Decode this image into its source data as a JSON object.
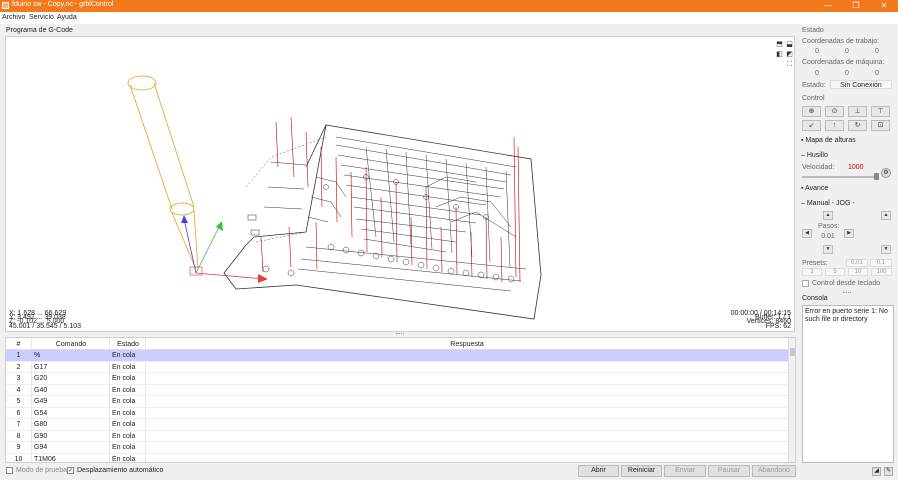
{
  "window": {
    "title": "fduino sw - Copy.nc - grblControl",
    "min": "—",
    "max": "❐",
    "close": "✕"
  },
  "menu": [
    "Archivo",
    "Servicio",
    "Ayuda"
  ],
  "gcode_section": "Programa de G-Code",
  "viewport": {
    "left_lines": [
      "X: 1.628 ... 66.629",
      "Y: 3.492 ... 39.038",
      "Z: -0.102 ... 5.000",
      "45.001 / 35.545 / 5.103"
    ],
    "right_lines": [
      "00:00:00 / 00:14:15",
      "Buffer: 1 / 1",
      "Vertices: 8460",
      "FPS: 62"
    ]
  },
  "table": {
    "headers": [
      "#",
      "Comando",
      "Estado",
      "Respuesta"
    ],
    "rows": [
      [
        "1",
        "%",
        "En cola",
        ""
      ],
      [
        "2",
        "G17",
        "En cola",
        ""
      ],
      [
        "3",
        "G20",
        "En cola",
        ""
      ],
      [
        "4",
        "G40",
        "En cola",
        ""
      ],
      [
        "5",
        "G49",
        "En cola",
        ""
      ],
      [
        "6",
        "G54",
        "En cola",
        ""
      ],
      [
        "7",
        "G80",
        "En cola",
        ""
      ],
      [
        "8",
        "G90",
        "En cola",
        ""
      ],
      [
        "9",
        "G94",
        "En cola",
        ""
      ],
      [
        "10",
        "T1M06",
        "En cola",
        ""
      ]
    ]
  },
  "bottom": {
    "test_mode": "Modo de prueba",
    "autoscroll": "Desplazamiento automático",
    "buttons": [
      "Abrir",
      "Reiniciar",
      "Enviar",
      "Pausar",
      "Abandono"
    ]
  },
  "panel": {
    "estado_title": "Estado",
    "work_coords": "Coordenadas de trabajo:",
    "work_values": [
      "0",
      "0",
      "0"
    ],
    "machine_coords": "Coordenadas de máquina:",
    "machine_values": [
      "0",
      "0",
      "0"
    ],
    "status_label": "Estado:",
    "status_value": "Sin Conexión",
    "control_title": "Control",
    "heightmap": "Mapa de alturas",
    "spindle": "Husillo",
    "speed_label": "Velocidad:",
    "speed_value": "1000",
    "feed": "Avance",
    "jog": "Manual - JOG -",
    "steps_label": "Pasos:",
    "steps_value": "0.01",
    "presets_label": "Presets:",
    "presets": [
      "0.01",
      "0.1",
      "1",
      "5",
      "10",
      "100"
    ],
    "keyboard": "Control desde teclado",
    "console_title": "Consola",
    "console_text": "Error en puerto serie 1: No such file or directory"
  },
  "colors": {
    "accent": "#f27a1d",
    "selected_row": "#ccccff",
    "speed_value": "#cc0000",
    "toolpath": "#cc0000",
    "tool": "#e8a020"
  }
}
